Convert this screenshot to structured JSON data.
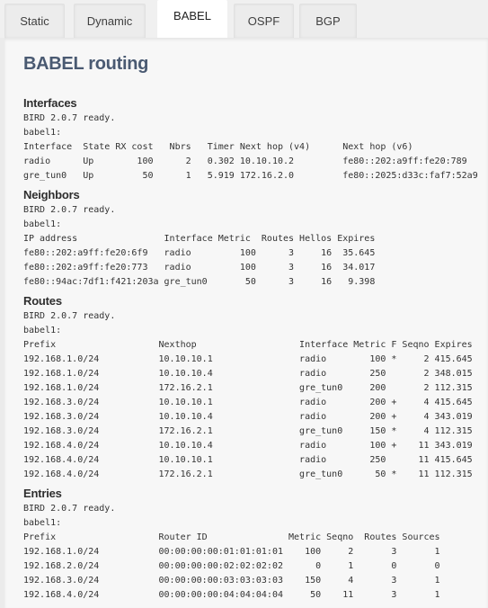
{
  "tabs": [
    {
      "label": "Static",
      "active": false
    },
    {
      "label": "Dynamic",
      "active": false
    },
    {
      "label": "BABEL",
      "active": true
    },
    {
      "label": "OSPF",
      "active": false
    },
    {
      "label": "BGP",
      "active": false
    }
  ],
  "page_title": "BABEL routing",
  "sections": {
    "interfaces": {
      "title": "Interfaces",
      "status_line": "BIRD 2.0.7 ready.",
      "protocol_line": "babel1:",
      "headers": [
        "Interface",
        "State",
        "RX cost",
        "Nbrs",
        "Timer",
        "Next hop (v4)",
        "Next hop (v6)"
      ],
      "rows": [
        [
          "radio",
          "Up",
          "100",
          "2",
          "0.302",
          "10.10.10.2",
          "fe80::202:a9ff:fe20:789"
        ],
        [
          "gre_tun0",
          "Up",
          "50",
          "1",
          "5.919",
          "172.16.2.0",
          "fe80::2025:d33c:faf7:52a9"
        ]
      ]
    },
    "neighbors": {
      "title": "Neighbors",
      "status_line": "BIRD 2.0.7 ready.",
      "protocol_line": "babel1:",
      "headers": [
        "IP address",
        "Interface",
        "Metric",
        "Routes",
        "Hellos",
        "Expires"
      ],
      "rows": [
        [
          "fe80::202:a9ff:fe20:6f9",
          "radio",
          "100",
          "3",
          "16",
          "35.645"
        ],
        [
          "fe80::202:a9ff:fe20:773",
          "radio",
          "100",
          "3",
          "16",
          "34.017"
        ],
        [
          "fe80::94ac:7df1:f421:203a",
          "gre_tun0",
          "50",
          "3",
          "16",
          "9.398"
        ]
      ]
    },
    "routes": {
      "title": "Routes",
      "status_line": "BIRD 2.0.7 ready.",
      "protocol_line": "babel1:",
      "headers": [
        "Prefix",
        "Nexthop",
        "Interface",
        "Metric",
        "F",
        "Seqno",
        "Expires"
      ],
      "rows": [
        [
          "192.168.1.0/24",
          "10.10.10.1",
          "radio",
          "100",
          "*",
          "2",
          "415.645"
        ],
        [
          "192.168.1.0/24",
          "10.10.10.4",
          "radio",
          "250",
          "",
          "2",
          "348.015"
        ],
        [
          "192.168.1.0/24",
          "172.16.2.1",
          "gre_tun0",
          "200",
          "",
          "2",
          "112.315"
        ],
        [
          "192.168.3.0/24",
          "10.10.10.1",
          "radio",
          "200",
          "+",
          "4",
          "415.645"
        ],
        [
          "192.168.3.0/24",
          "10.10.10.4",
          "radio",
          "200",
          "+",
          "4",
          "343.019"
        ],
        [
          "192.168.3.0/24",
          "172.16.2.1",
          "gre_tun0",
          "150",
          "*",
          "4",
          "112.315"
        ],
        [
          "192.168.4.0/24",
          "10.10.10.4",
          "radio",
          "100",
          "+",
          "11",
          "343.019"
        ],
        [
          "192.168.4.0/24",
          "10.10.10.1",
          "radio",
          "250",
          "",
          "11",
          "415.645"
        ],
        [
          "192.168.4.0/24",
          "172.16.2.1",
          "gre_tun0",
          "50",
          "*",
          "11",
          "112.315"
        ]
      ]
    },
    "entries": {
      "title": "Entries",
      "status_line": "BIRD 2.0.7 ready.",
      "protocol_line": "babel1:",
      "headers": [
        "Prefix",
        "Router ID",
        "Metric",
        "Seqno",
        "Routes",
        "Sources"
      ],
      "rows": [
        [
          "192.168.1.0/24",
          "00:00:00:00:01:01:01:01",
          "100",
          "2",
          "3",
          "1"
        ],
        [
          "192.168.2.0/24",
          "00:00:00:00:02:02:02:02",
          "0",
          "1",
          "0",
          "0"
        ],
        [
          "192.168.3.0/24",
          "00:00:00:00:03:03:03:03",
          "150",
          "4",
          "3",
          "1"
        ],
        [
          "192.168.4.0/24",
          "00:00:00:00:04:04:04:04",
          "50",
          "11",
          "3",
          "1"
        ]
      ]
    }
  }
}
